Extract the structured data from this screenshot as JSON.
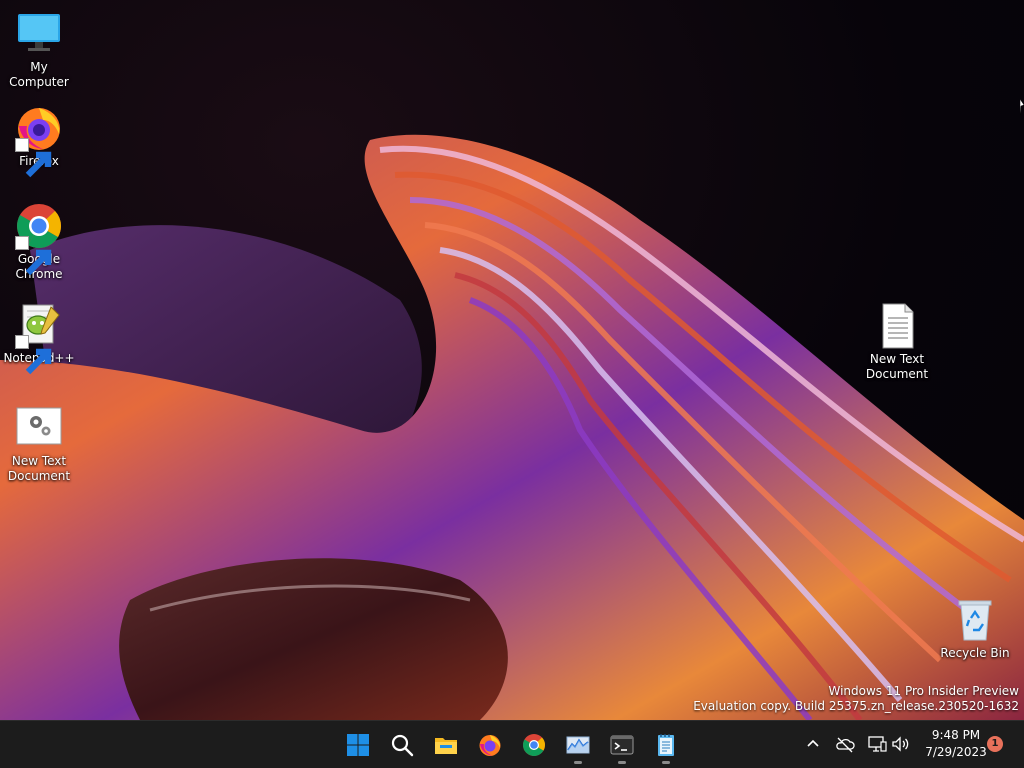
{
  "desktop": {
    "icons": [
      {
        "label": "My Computer"
      },
      {
        "label": "Firefox"
      },
      {
        "label": "Google\nChrome"
      },
      {
        "label": "Notepad++"
      },
      {
        "label": "New Text\nDocument"
      },
      {
        "label": "New Text\nDocument"
      },
      {
        "label": "Recycle Bin"
      }
    ]
  },
  "watermark": {
    "line1": "Windows 11 Pro Insider Preview",
    "line2": "Evaluation copy. Build 25375.zn_release.230520-1632"
  },
  "taskbar": {
    "apps": [
      {
        "icon": "windows-start-icon",
        "running": false
      },
      {
        "icon": "search-icon",
        "running": false
      },
      {
        "icon": "file-explorer-icon",
        "running": false
      },
      {
        "icon": "firefox-icon",
        "running": false
      },
      {
        "icon": "chrome-icon",
        "running": false
      },
      {
        "icon": "task-manager-icon",
        "running": true
      },
      {
        "icon": "terminal-icon",
        "running": true
      },
      {
        "icon": "notepad-icon",
        "running": true
      }
    ],
    "tray": {
      "icons": [
        "chevron-up-icon",
        "onedrive-offline-icon",
        "network-icon",
        "volume-icon"
      ],
      "time": "9:48 PM",
      "date": "7/29/2023",
      "notification_count": "1"
    }
  },
  "colors": {
    "taskbar_bg": "#1c1c1c",
    "windows_blue": "#1e8fe6",
    "notification": "#e8715b"
  }
}
